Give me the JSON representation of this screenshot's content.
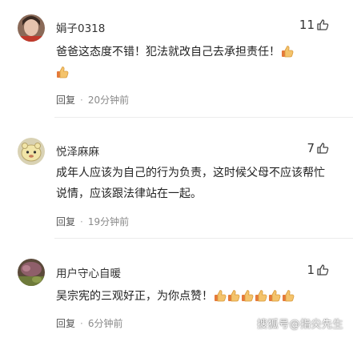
{
  "comments": [
    {
      "username": "娟子0318",
      "likes": "11",
      "text": "爸爸这态度不错！犯法就改自己去承担责任！",
      "emoji_count": 2,
      "reply_label": "回复",
      "time": "20分钟前"
    },
    {
      "username": "悦泽麻麻",
      "likes": "7",
      "text": "成年人应该为自己的行为负责，这时候父母不应该帮忙说情，应该跟法律站在一起。",
      "emoji_count": 0,
      "reply_label": "回复",
      "time": "19分钟前"
    },
    {
      "username": "用户守心自暖",
      "likes": "1",
      "text": "吴宗宪的三观好正，为你点赞！",
      "emoji_count": 6,
      "reply_label": "回复",
      "time": "6分钟前"
    }
  ],
  "watermark": "搜狐号@指尖先生",
  "colors": {
    "meta": "#8a8a8a",
    "emoji_skin": "#f4c36b",
    "emoji_sleeve": "#e57a3a"
  },
  "icons": {
    "like": "thumbs-up-outline-icon",
    "emoji": "thumbs-up-emoji-icon"
  }
}
